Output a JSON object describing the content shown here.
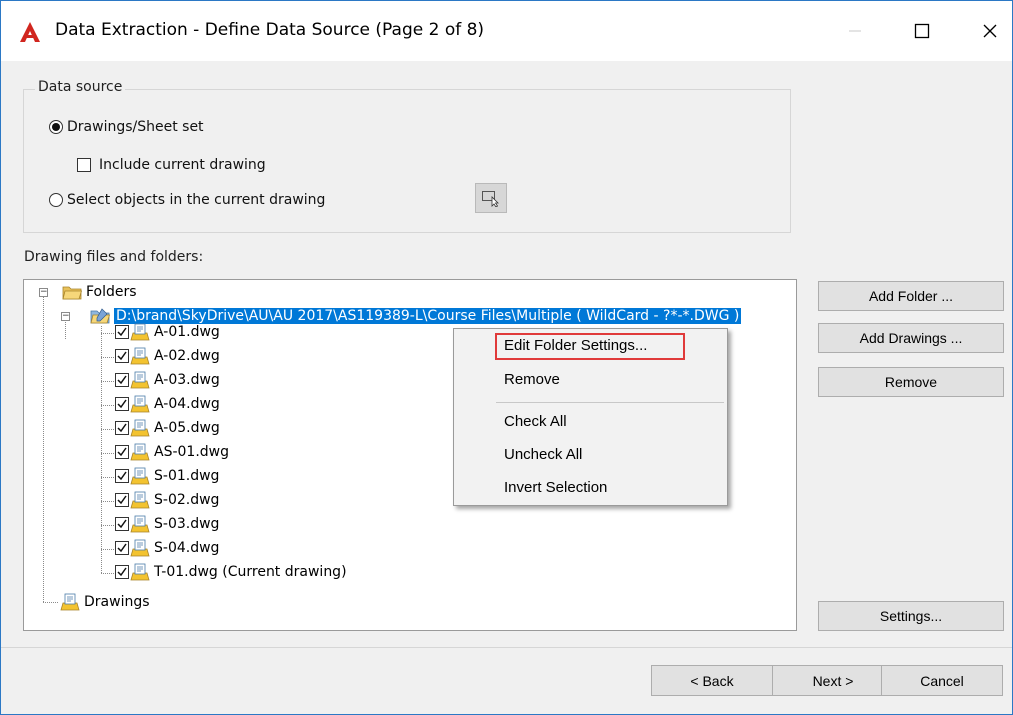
{
  "window": {
    "title": "Data Extraction - Define Data Source (Page 2 of 8)",
    "controls": {
      "minimize_icon": "minimize-icon",
      "maximize_icon": "maximize-icon",
      "close_icon": "close-icon"
    },
    "accent_color": "#0078d7"
  },
  "data_source": {
    "legend": "Data source",
    "option_drawings": {
      "label": "Drawings/Sheet set",
      "selected": true
    },
    "include_current": {
      "label": "Include current drawing",
      "checked": false
    },
    "option_select_objects": {
      "label": "Select objects in the current drawing",
      "selected": false
    }
  },
  "tree": {
    "label": "Drawing files and folders:",
    "root_label": "Folders",
    "folder_path": "D:\\brand\\SkyDrive\\AU\\AU 2017\\AS119389-L\\Course Files\\Multiple ( WildCard - ?*-*.DWG )",
    "files": [
      "A-01.dwg",
      "A-02.dwg",
      "A-03.dwg",
      "A-04.dwg",
      "A-05.dwg",
      "AS-01.dwg",
      "S-01.dwg",
      "S-02.dwg",
      "S-03.dwg",
      "S-04.dwg",
      "T-01.dwg (Current drawing)"
    ],
    "drawings_label": "Drawings"
  },
  "side_buttons": {
    "add_folder": "Add Folder ...",
    "add_drawings": "Add Drawings ...",
    "remove": "Remove",
    "settings": "Settings..."
  },
  "context_menu": {
    "edit_folder_settings": "Edit Folder Settings...",
    "remove": "Remove",
    "check_all": "Check All",
    "uncheck_all": "Uncheck All",
    "invert_selection": "Invert Selection"
  },
  "footer": {
    "back": "< Back",
    "next": "Next >",
    "cancel": "Cancel"
  }
}
